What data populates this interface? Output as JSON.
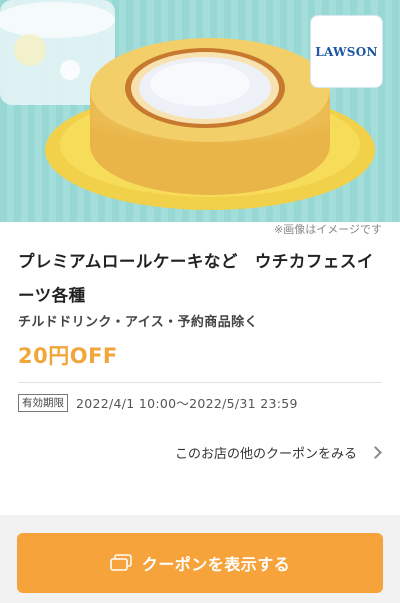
{
  "hero": {
    "image_alt": "roll cake on plate",
    "logo_text": "LAWSON"
  },
  "image_note": "※画像はイメージです",
  "product": {
    "title": "プレミアムロールケーキなど　ウチカフェスイーツ各種",
    "exclusions": "チルドドリンク・アイス・予約商品除く",
    "discount": "20円OFF"
  },
  "validity": {
    "badge": "有効期限",
    "period": "2022/4/1 10:00〜2022/5/31 23:59"
  },
  "more_coupons": {
    "label": "このお店の他のクーポンをみる"
  },
  "cta": {
    "label": "クーポンを表示する"
  },
  "colors": {
    "accent": "#f6a33b",
    "discount": "#f0a63a",
    "hero_bg": "#9fdcd8",
    "logo": "#1f57a4"
  },
  "icons": [
    "lawson-logo",
    "chevron-right-icon",
    "coupon-icon"
  ]
}
